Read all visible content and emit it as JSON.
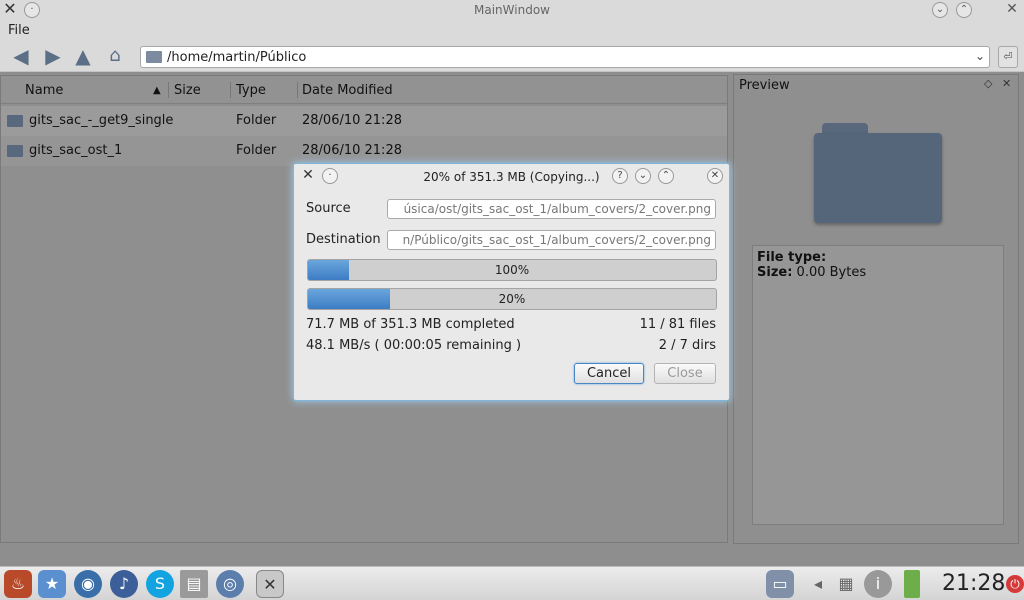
{
  "window": {
    "title": "MainWindow"
  },
  "menu": {
    "file": "File"
  },
  "address": {
    "path": "/home/martin/Público"
  },
  "columns": {
    "name": "Name",
    "size": "Size",
    "type": "Type",
    "date": "Date Modified"
  },
  "files": [
    {
      "name": "gits_sac_-_get9_single",
      "size": "",
      "type": "Folder",
      "date": "28/06/10 21:28"
    },
    {
      "name": "gits_sac_ost_1",
      "size": "",
      "type": "Folder",
      "date": "28/06/10 21:28"
    }
  ],
  "preview": {
    "title": "Preview",
    "file_type_label": "File type:",
    "file_type_value": "",
    "size_label": "Size:",
    "size_value": "0.00 Bytes"
  },
  "dialog": {
    "title": "20% of 351.3 MB (Copying...)",
    "source_label": "Source",
    "source_value": "úsica/ost/gits_sac_ost_1/album_covers/2_cover.png",
    "destination_label": "Destination",
    "destination_value": "n/Público/gits_sac_ost_1/album_covers/2_cover.png",
    "file_progress": {
      "text": "100%",
      "fraction": 0.1
    },
    "total_progress": {
      "text": "20%",
      "fraction": 0.2
    },
    "completed": "71.7 MB of 351.3 MB completed",
    "files": "11 / 81 files",
    "speed": "48.1 MB/s ( 00:00:05 remaining )",
    "dirs": "2 / 7 dirs",
    "cancel": "Cancel",
    "close": "Close"
  },
  "taskbar": {
    "clock": "21:28"
  },
  "colors": {
    "progress": "#4a8ad0",
    "dialog_glow": "#9fd0f2"
  }
}
